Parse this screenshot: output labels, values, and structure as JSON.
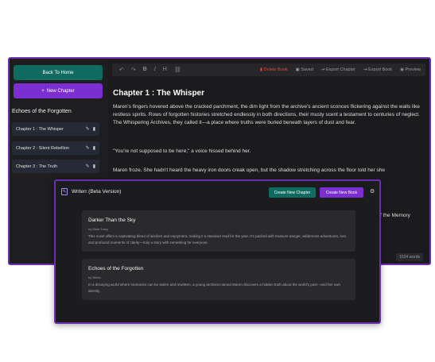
{
  "editor": {
    "sidebar": {
      "back_label": "Back To Home",
      "new_chapter_label": "New Chapter",
      "book_title": "Echoes of the Forgotten",
      "chapters": [
        {
          "label": "Chapter 1 : The Whisper"
        },
        {
          "label": "Chapter 2 : Silent Rebellion"
        },
        {
          "label": "Chapter 3 : The Truth"
        }
      ]
    },
    "toolbar": {
      "undo": "↶",
      "redo": "↷",
      "bold": "B",
      "italic": "I",
      "heading": "H",
      "link": "⛓",
      "delete_label": "Delete Book",
      "saved_label": "Saved",
      "export_chapter_label": "Export Chapter",
      "export_book_label": "Export Book",
      "preview_label": "Preview"
    },
    "chapter_heading": "Chapter 1 : The Whisper",
    "paragraphs": [
      "Maren's fingers hovered above the cracked parchment, the dim light from the archive's ancient sconces flickering against the walls like restless spirits. Rows of forgotten histories stretched endlessly in both directions, their musty scent a testament to centuries of neglect. The Whispering Archives, they called it—a place where truths were buried beneath layers of dust and fear.",
      "\"You're not supposed to be here,\" a voice hissed behind her.",
      "Maren froze. She hadn't heard the heavy iron doors creak open, but the shadow stretching across the floor told her she"
    ],
    "peek_text": "f the Memory",
    "word_count": "1524 words"
  },
  "library": {
    "title": "Writerr (Beta Version)",
    "create_chapter_label": "Create New Chapter",
    "create_book_label": "Create New Book",
    "books": [
      {
        "title": "Darker Than the Sky",
        "author": "by Mark Tracy",
        "description": "This novel offers a captivating blend of wisdom and enjoyment, making it a standout read for the year. It's packed with treasure danger, wilderness adventures, lore, and profound moments of clarity—truly a story with something for everyone."
      },
      {
        "title": "Echoes of the Forgotten",
        "author": "by Writer",
        "description": "In a decaying world where memories can be stolen and rewritten, a young archivist named Maren discovers a hidden truth about the world's past—and her own identity."
      }
    ]
  },
  "icons": {
    "plus": "+",
    "edit": "✎",
    "trash": "🗑",
    "gear": "⚙",
    "save": "💾",
    "export": "⇥",
    "eye": "👁"
  },
  "colors": {
    "teal": "#0f6b60",
    "purple": "#7b2fd0",
    "danger": "#e0493b",
    "border": "#6b2fb3"
  }
}
